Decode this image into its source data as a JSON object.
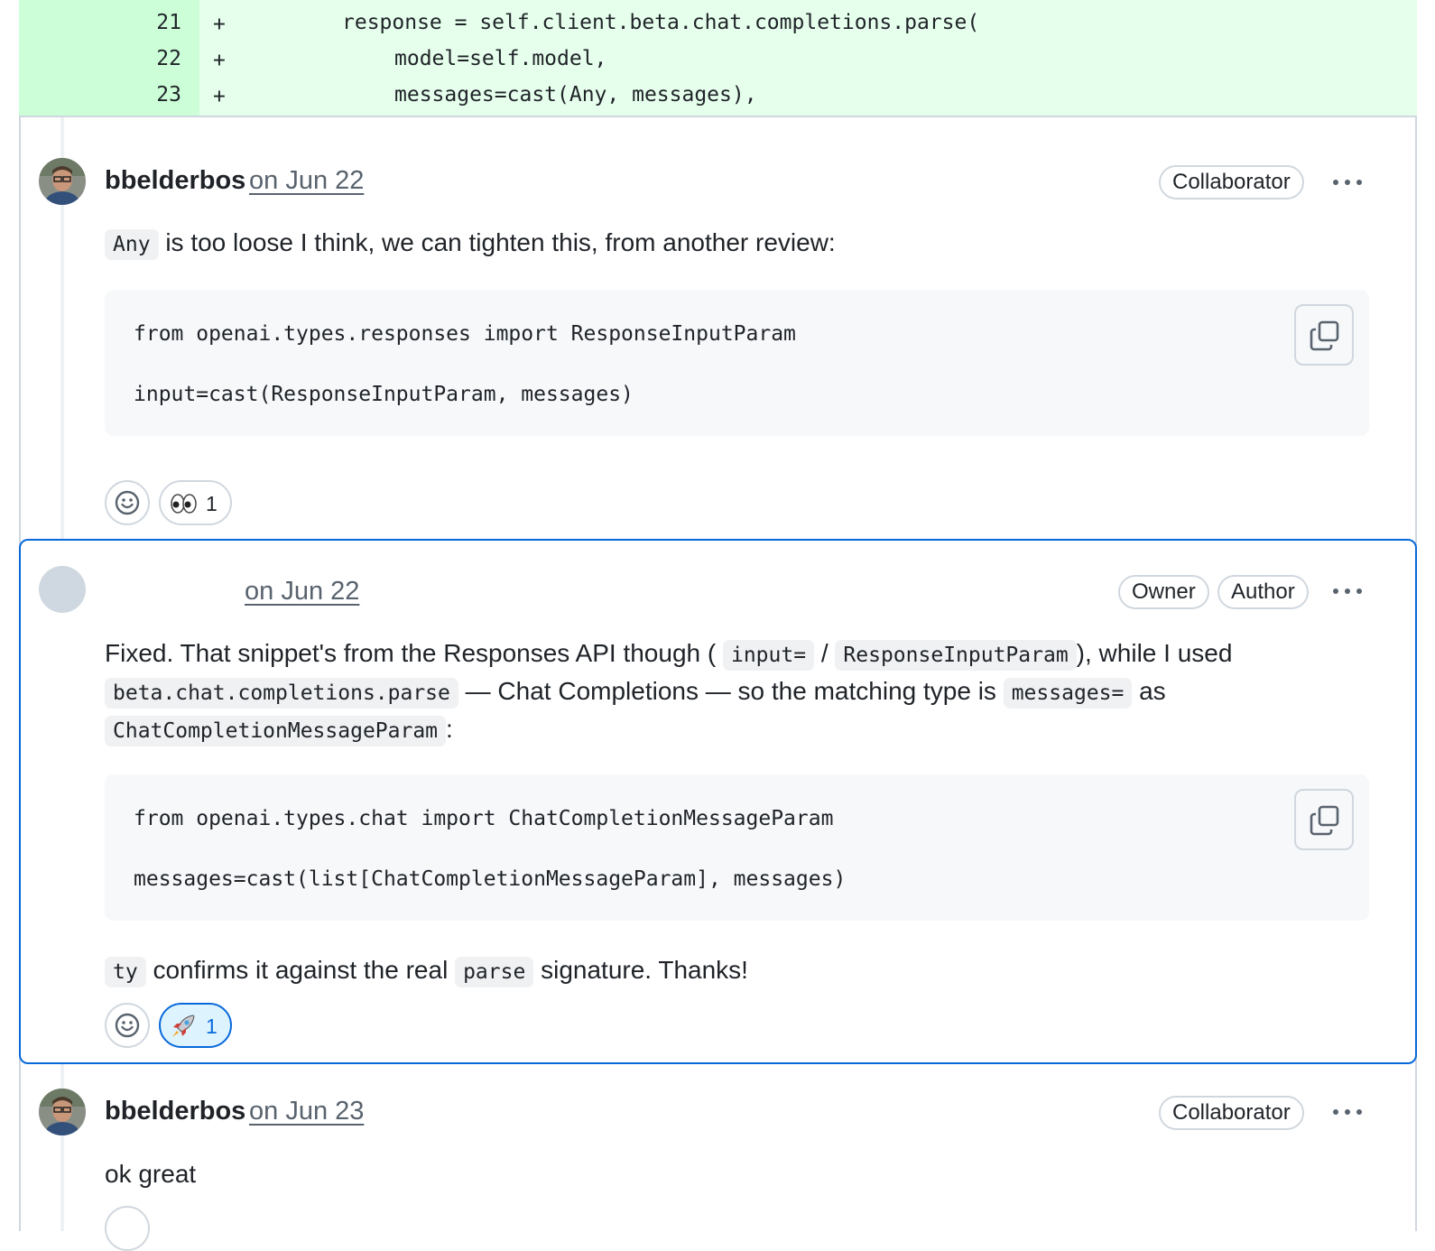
{
  "diff": {
    "lines": [
      {
        "num": "21",
        "sign": "+",
        "code": "response = self.client.beta.chat.completions.parse("
      },
      {
        "num": "22",
        "sign": "+",
        "code": "model=self.model,"
      },
      {
        "num": "23",
        "sign": "+",
        "code": "messages=cast(Any, messages),"
      }
    ]
  },
  "comments": [
    {
      "author": "bbelderbos",
      "date": "on Jun 22",
      "badges": [
        "Collaborator"
      ],
      "text": {
        "code1": "Any",
        "t1": "is too loose I think, we can tighten this, from another review:"
      },
      "codeblock": {
        "line1": "from openai.types.responses import ResponseInputParam",
        "line2": "input=cast(ResponseInputParam, messages)"
      },
      "reactions": [
        {
          "emoji": "eyes-emoji",
          "count": "1",
          "active": false
        }
      ]
    },
    {
      "author": "",
      "date": "on Jun 22",
      "badges": [
        "Owner",
        "Author"
      ],
      "text": {
        "p1_a": "Fixed. That snippet's from the Responses API though (",
        "p1_c1": "input=",
        "p1_b": "/",
        "p1_c2": "ResponseInputParam",
        "p1_d": "), while I used",
        "p2_c1": "beta.chat.completions.parse",
        "p2_a": "— Chat Completions — so the matching type is",
        "p2_c2": "messages=",
        "p2_b": "as",
        "p3_c1": "ChatCompletionMessageParam",
        "p3_a": ":",
        "p4_c1": "ty",
        "p4_a": "confirms it against the real",
        "p4_c2": "parse",
        "p4_b": "signature. Thanks!"
      },
      "codeblock": {
        "line1": "from openai.types.chat import ChatCompletionMessageParam",
        "line2": "messages=cast(list[ChatCompletionMessageParam], messages)"
      },
      "reactions": [
        {
          "emoji": "rocket-emoji",
          "count": "1",
          "active": true
        }
      ]
    },
    {
      "author": "bbelderbos",
      "date": "on Jun 23",
      "badges": [
        "Collaborator"
      ],
      "text": {
        "t1": "ok great"
      }
    }
  ],
  "colors": {
    "diff_add_bg": "#e6ffec",
    "diff_add_gutter": "#ccffd8",
    "highlight_border": "#0969da",
    "active_reaction_bg": "#ddf4ff"
  }
}
